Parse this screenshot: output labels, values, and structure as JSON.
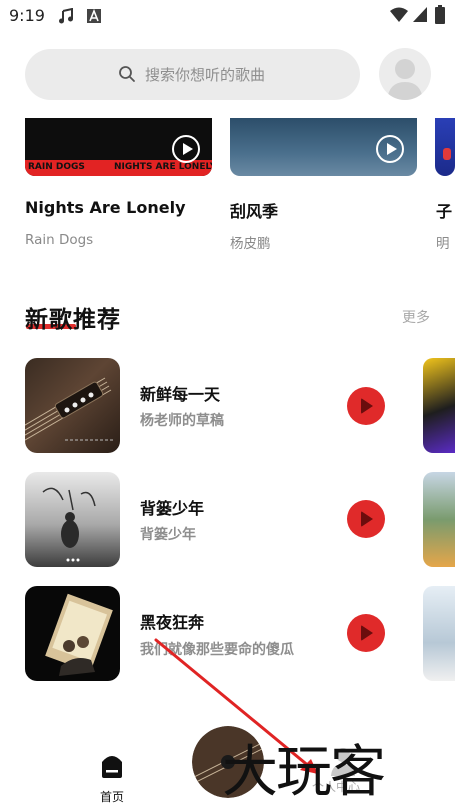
{
  "status_bar": {
    "time": "9:19"
  },
  "search": {
    "placeholder": "搜索你想听的歌曲"
  },
  "playlists": [
    {
      "title": "Nights Are Lonely",
      "artist": "Rain Dogs",
      "cover_left": "RAIN DOGS",
      "cover_right": "NIGHTS ARE LONELY"
    },
    {
      "title": "刮风季",
      "artist": "杨皮鹏"
    },
    {
      "title": "子",
      "artist": "明"
    }
  ],
  "section": {
    "title": "新歌推荐",
    "more": "更多"
  },
  "songs": [
    {
      "title": "新鲜每一天",
      "subtitle": "杨老师的草稿"
    },
    {
      "title": "背篓少年",
      "subtitle": "背篓少年"
    },
    {
      "title": "黑夜狂奔",
      "subtitle": "我们就像那些要命的傻瓜"
    }
  ],
  "bottom_nav": {
    "home": "首页",
    "profile": "个人中心"
  },
  "watermark": "大玩客",
  "colors": {
    "accent": "#e02a2a",
    "play_button": "#e02a2a",
    "muted_text": "#8e8e8e",
    "search_bg": "#ebebeb"
  }
}
